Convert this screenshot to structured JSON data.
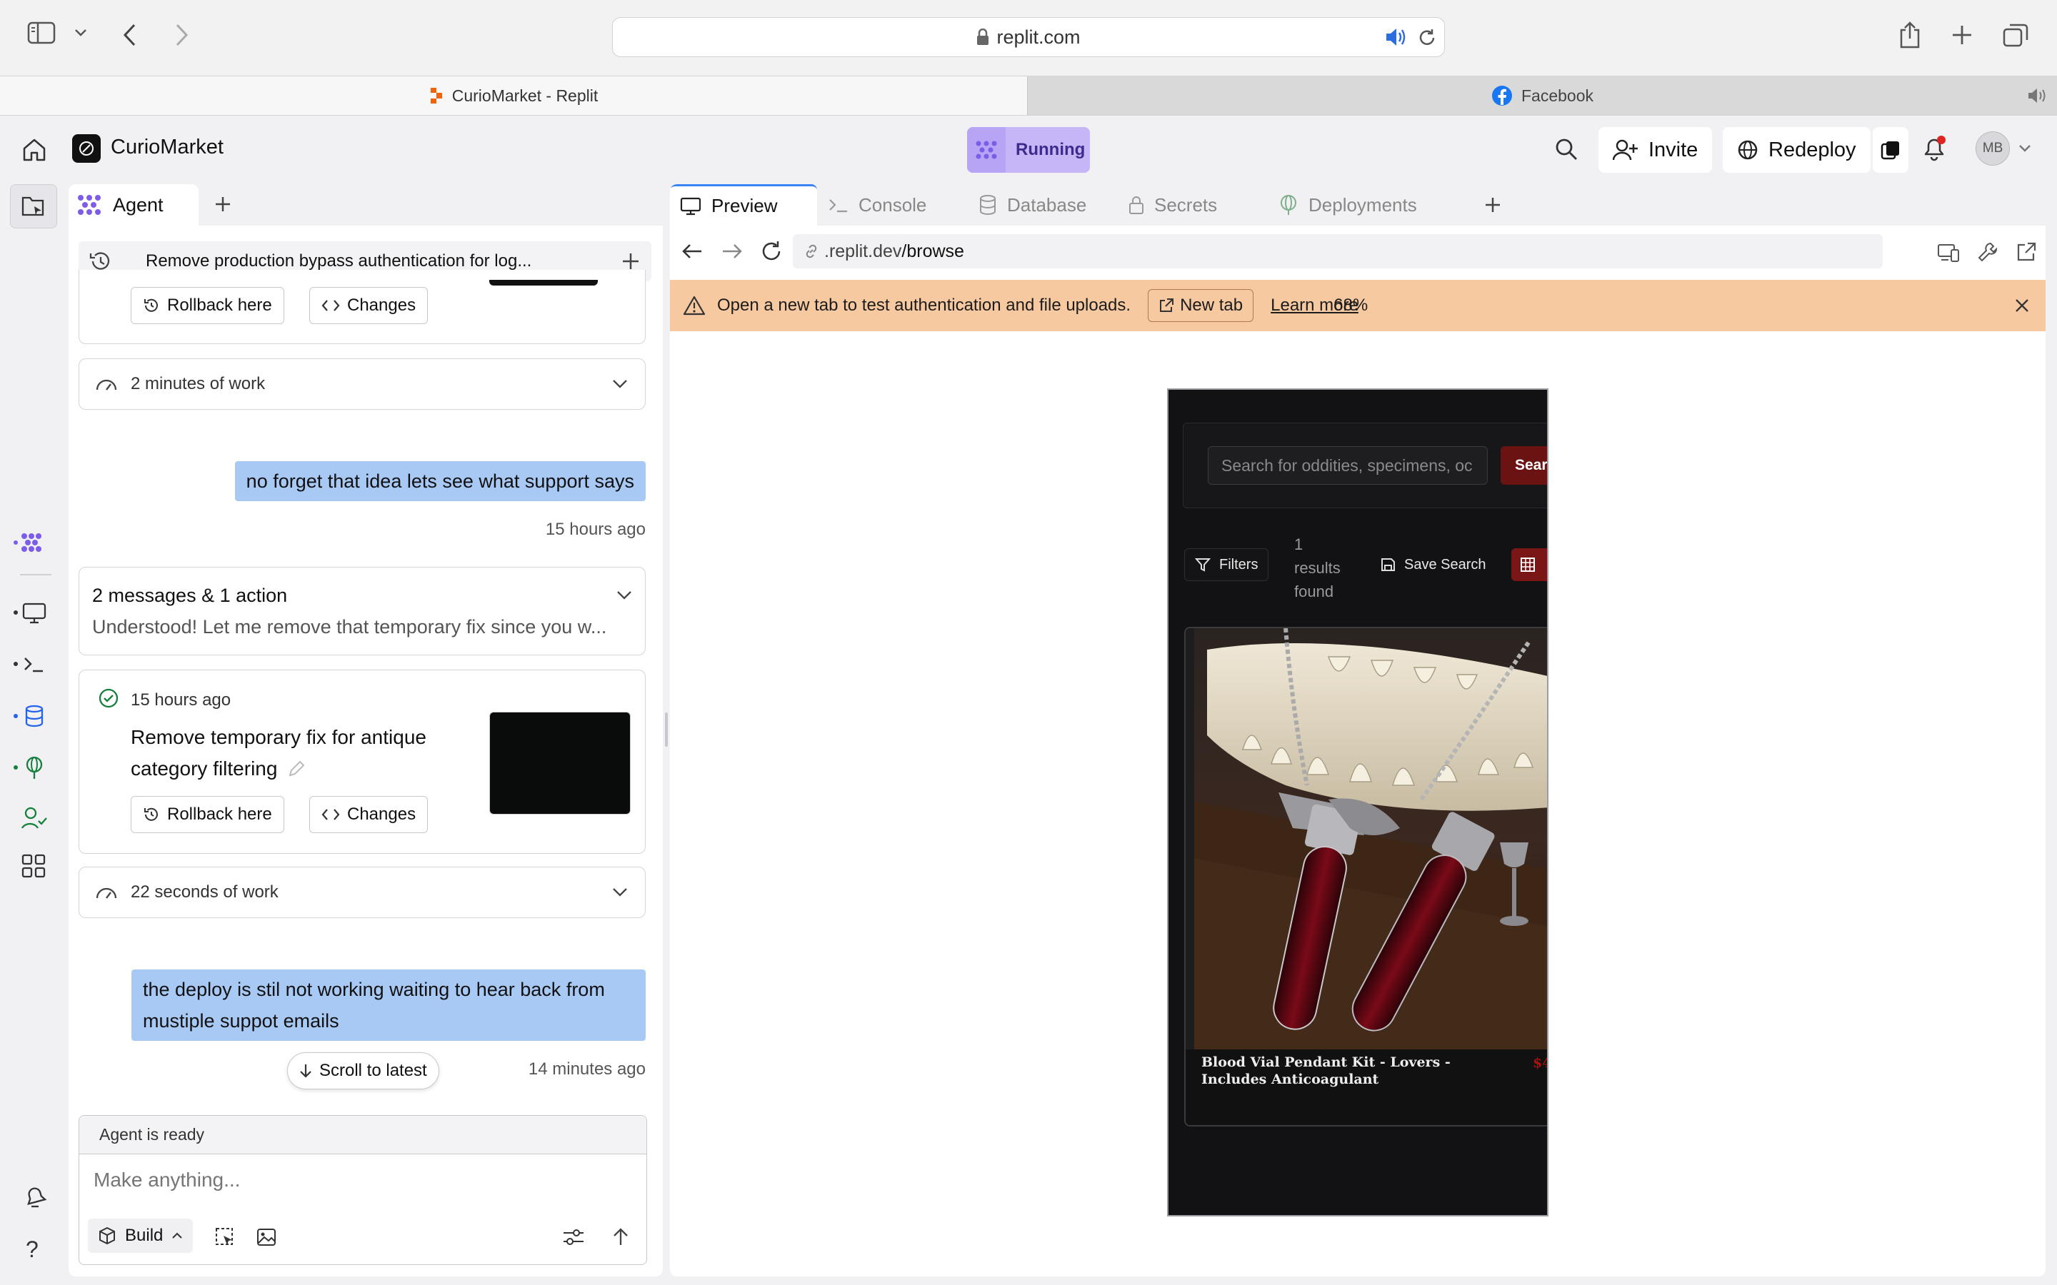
{
  "browser": {
    "url": "replit.com",
    "tabs": [
      {
        "label": "CurioMarket - Replit"
      },
      {
        "label": "Facebook"
      }
    ]
  },
  "header": {
    "project_name": "CurioMarket",
    "status": "Running",
    "invite_label": "Invite",
    "redeploy_label": "Redeploy",
    "avatar_initials": "MB"
  },
  "agent": {
    "tab_label": "Agent",
    "thread_title": "Remove production bypass authentication for log...",
    "top_actions": {
      "rollback": "Rollback here",
      "changes": "Changes"
    },
    "work1": "2 minutes of work",
    "user_msg1": "no forget that idea lets see what support says",
    "user_msg1_time": "15 hours ago",
    "summary": {
      "title": "2 messages & 1 action",
      "preview": "Understood! Let me remove that temporary fix since you w..."
    },
    "checkpoint": {
      "time": "15 hours ago",
      "title_line1": "Remove temporary fix for antique",
      "title_line2": "category filtering",
      "rollback": "Rollback here",
      "changes": "Changes"
    },
    "work2": "22 seconds of work",
    "user_msg2_line1": "the deploy is stil not working waiting to hear back from",
    "user_msg2_line2": "mustiple suppot emails",
    "user_msg2_time": "14 minutes ago",
    "scroll_latest": "Scroll to latest",
    "status_text": "Agent is ready",
    "input_placeholder": "Make anything...",
    "build_label": "Build"
  },
  "preview": {
    "tabs": [
      "Preview",
      "Console",
      "Database",
      "Secrets",
      "Deployments"
    ],
    "address_prefix": ".replit.dev",
    "address_path": "/browse",
    "banner": {
      "text": "Open a new tab to test authentication and file uploads.",
      "new_tab": "New tab",
      "learn_more": "Learn more",
      "zoom": "68%"
    },
    "app": {
      "search_placeholder": "Search for oddities, specimens, oc",
      "search_button": "Sear",
      "filters": "Filters",
      "results_line1": "1",
      "results_line2": "results",
      "results_line3": "found",
      "save_search": "Save Search",
      "product_title": "Blood Vial Pendant Kit - Lovers - Includes Anticoagulant",
      "product_price": "$4"
    }
  }
}
